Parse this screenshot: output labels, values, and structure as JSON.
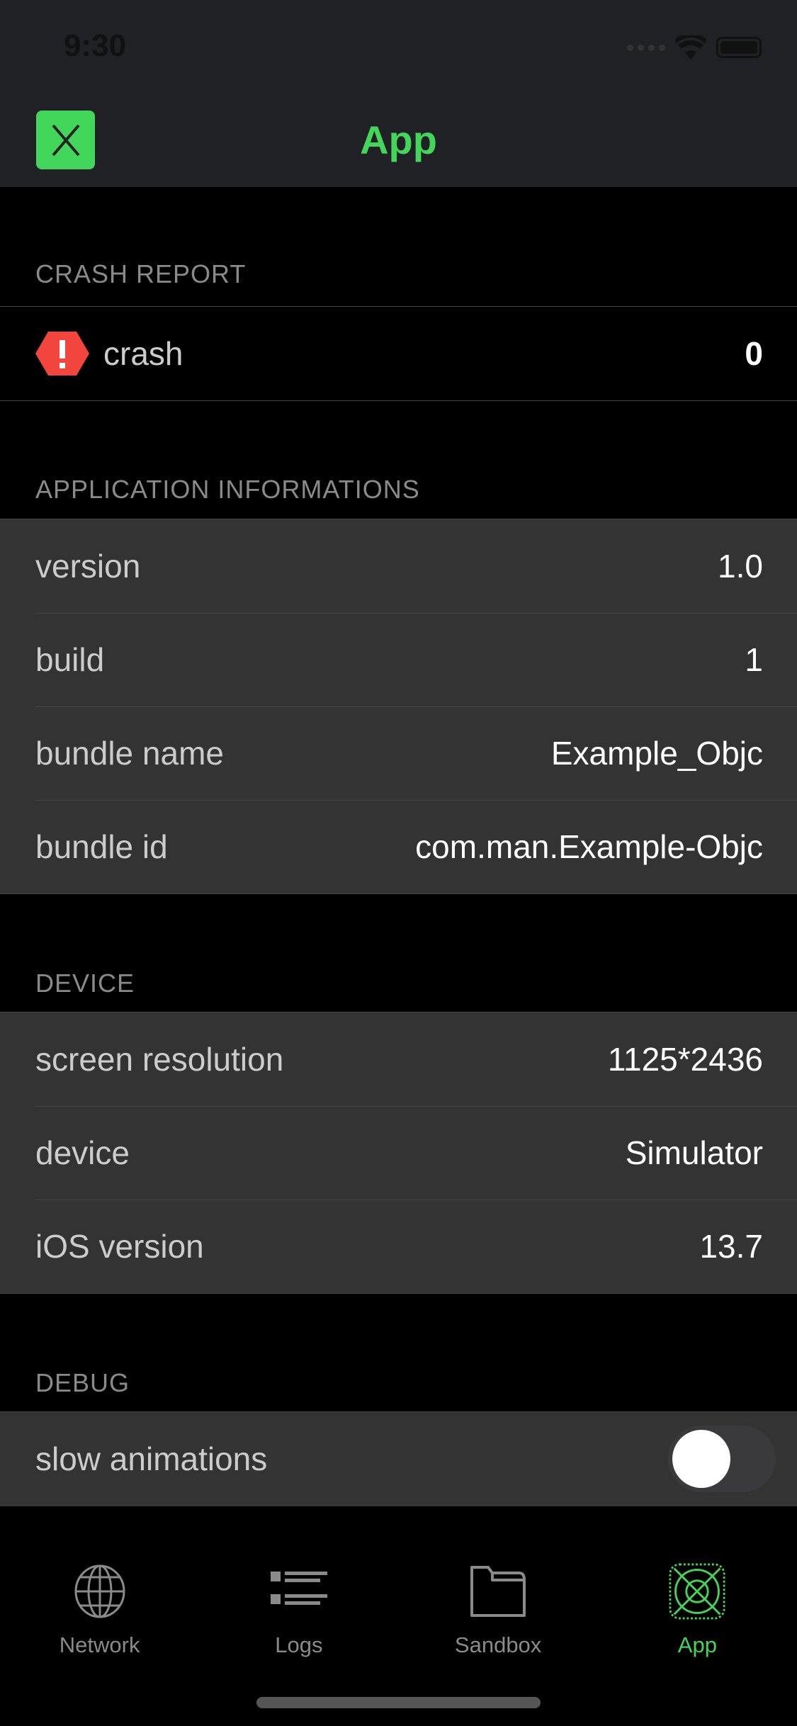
{
  "status_bar": {
    "time": "9:30"
  },
  "nav": {
    "title": "App",
    "close_icon": "close-icon"
  },
  "sections": {
    "crash_report": {
      "header": "CRASH REPORT",
      "label": "crash",
      "value": "0"
    },
    "app_info": {
      "header": "APPLICATION INFORMATIONS",
      "rows": [
        {
          "label": "version",
          "value": "1.0"
        },
        {
          "label": "build",
          "value": "1"
        },
        {
          "label": "bundle name",
          "value": "Example_Objc"
        },
        {
          "label": "bundle id",
          "value": "com.man.Example-Objc"
        }
      ]
    },
    "device": {
      "header": "DEVICE",
      "rows": [
        {
          "label": "screen resolution",
          "value": "1125*2436"
        },
        {
          "label": "device",
          "value": "Simulator"
        },
        {
          "label": "iOS version",
          "value": "13.7"
        }
      ]
    },
    "debug": {
      "header": "DEBUG",
      "rows": [
        {
          "label": "slow animations",
          "enabled": false
        }
      ]
    }
  },
  "tabs": [
    {
      "label": "Network",
      "icon": "globe-icon"
    },
    {
      "label": "Logs",
      "icon": "list-icon"
    },
    {
      "label": "Sandbox",
      "icon": "folder-icon"
    },
    {
      "label": "App",
      "icon": "app-icon",
      "active": true
    }
  ],
  "colors": {
    "accent": "#42d65a",
    "crash": "#f2453d"
  }
}
